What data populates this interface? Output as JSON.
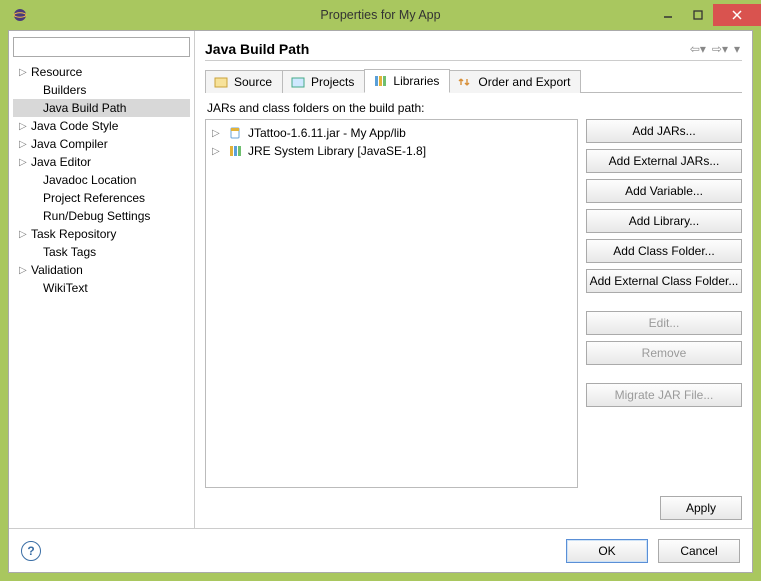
{
  "window": {
    "title": "Properties for My App"
  },
  "filter": {
    "value": ""
  },
  "tree": {
    "items": [
      {
        "label": "Resource",
        "expandable": true
      },
      {
        "label": "Builders",
        "expandable": false
      },
      {
        "label": "Java Build Path",
        "expandable": false,
        "selected": true
      },
      {
        "label": "Java Code Style",
        "expandable": true
      },
      {
        "label": "Java Compiler",
        "expandable": true
      },
      {
        "label": "Java Editor",
        "expandable": true
      },
      {
        "label": "Javadoc Location",
        "expandable": false
      },
      {
        "label": "Project References",
        "expandable": false
      },
      {
        "label": "Run/Debug Settings",
        "expandable": false
      },
      {
        "label": "Task Repository",
        "expandable": true
      },
      {
        "label": "Task Tags",
        "expandable": false
      },
      {
        "label": "Validation",
        "expandable": true
      },
      {
        "label": "WikiText",
        "expandable": false
      }
    ]
  },
  "page": {
    "heading": "Java Build Path",
    "tabs": [
      {
        "id": "source",
        "label": "Source",
        "icon": "source"
      },
      {
        "id": "projects",
        "label": "Projects",
        "icon": "projects"
      },
      {
        "id": "libraries",
        "label": "Libraries",
        "icon": "libraries",
        "active": true
      },
      {
        "id": "order",
        "label": "Order and Export",
        "icon": "order"
      }
    ],
    "sub_caption": "JARs and class folders on the build path:",
    "libs": [
      {
        "label": "JTattoo-1.6.11.jar - My App/lib",
        "icon": "jar"
      },
      {
        "label": "JRE System Library [JavaSE-1.8]",
        "icon": "jre"
      }
    ],
    "buttons": {
      "add_jars": "Add JARs...",
      "add_ext_jars": "Add External JARs...",
      "add_variable": "Add Variable...",
      "add_library": "Add Library...",
      "add_class_folder": "Add Class Folder...",
      "add_ext_class_folder": "Add External Class Folder...",
      "edit": "Edit...",
      "remove": "Remove",
      "migrate": "Migrate JAR File..."
    },
    "apply": "Apply"
  },
  "bottom": {
    "ok": "OK",
    "cancel": "Cancel"
  },
  "colors": {
    "titlebar": "#a9c75f",
    "close": "#d9534f"
  }
}
